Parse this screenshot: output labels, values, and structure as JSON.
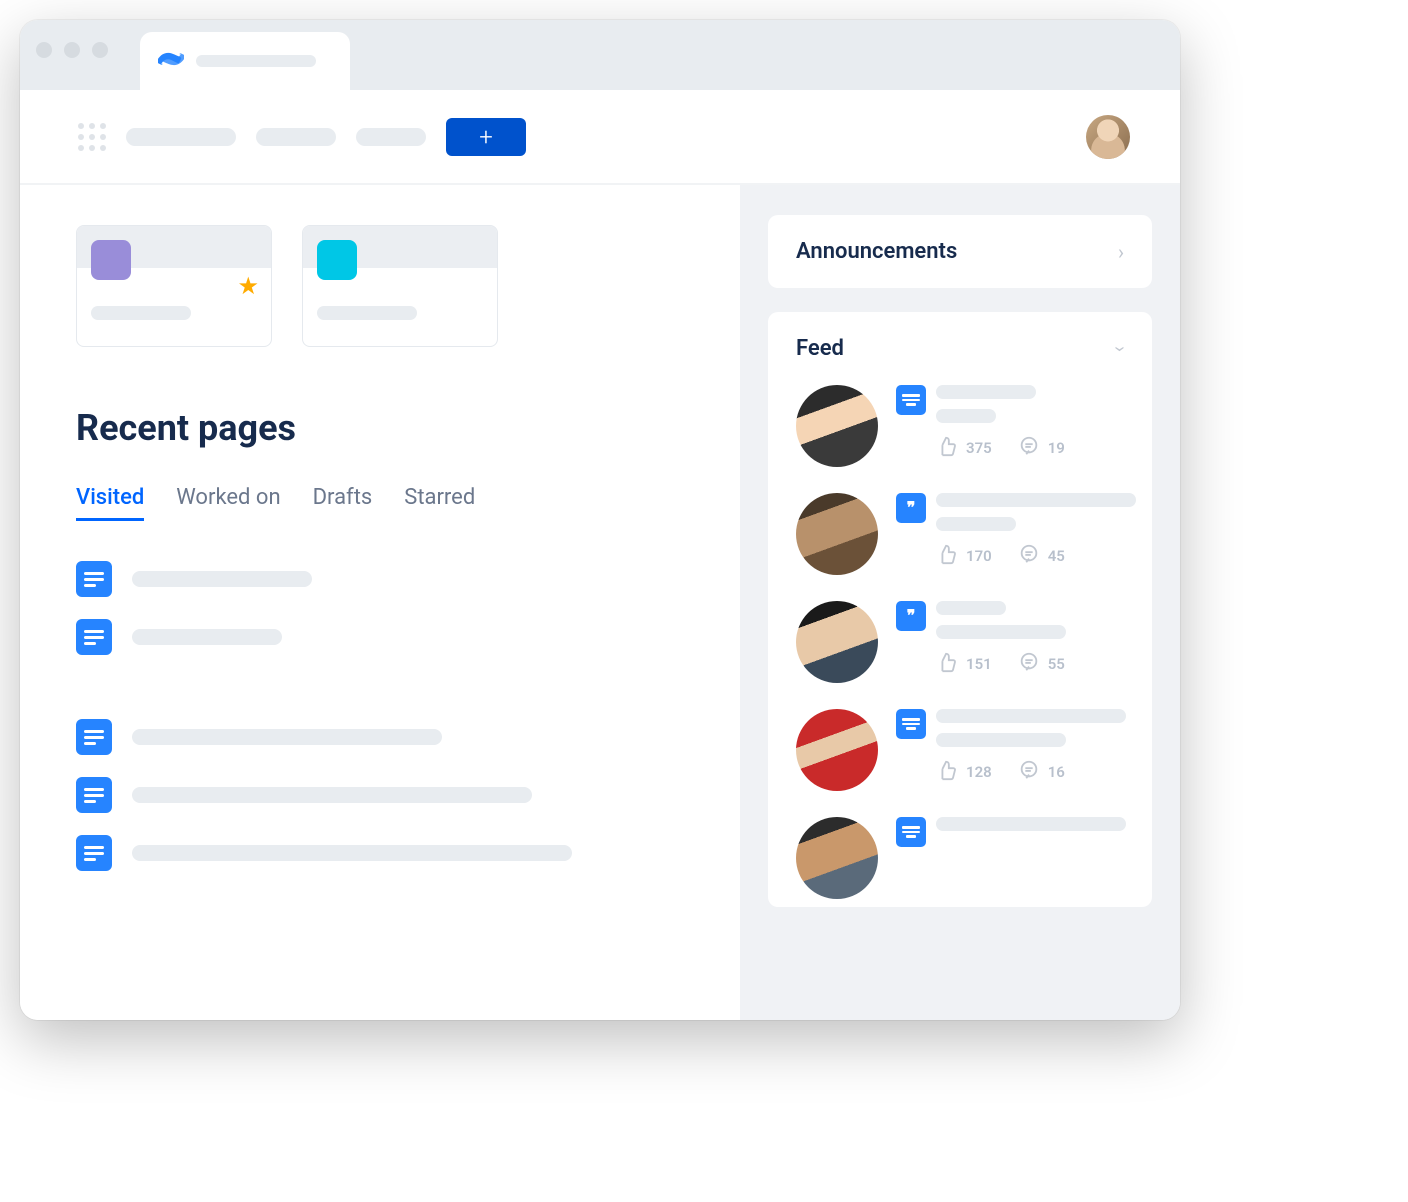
{
  "main": {
    "heading": "Recent pages",
    "tabs": [
      "Visited",
      "Worked on",
      "Drafts",
      "Starred"
    ],
    "active_tab": 0,
    "space_cards": [
      {
        "color": "purple",
        "starred": true
      },
      {
        "color": "teal",
        "starred": false
      }
    ],
    "page_list_widths": [
      180,
      150,
      0,
      310,
      400,
      440
    ]
  },
  "sidebar": {
    "announcements_title": "Announcements",
    "feed_title": "Feed",
    "feed": [
      {
        "avatar": "av1",
        "type": "page",
        "line1": 100,
        "line2": 60,
        "likes": 375,
        "comments": 19
      },
      {
        "avatar": "av2",
        "type": "quote",
        "line1": 200,
        "line2": 80,
        "likes": 170,
        "comments": 45
      },
      {
        "avatar": "av3",
        "type": "quote",
        "line1": 70,
        "line2": 130,
        "likes": 151,
        "comments": 55
      },
      {
        "avatar": "av4",
        "type": "page",
        "line1": 190,
        "line2": 130,
        "likes": 128,
        "comments": 16
      },
      {
        "avatar": "av5",
        "type": "page",
        "line1": 190,
        "line2": 0,
        "likes": null,
        "comments": null
      }
    ]
  }
}
